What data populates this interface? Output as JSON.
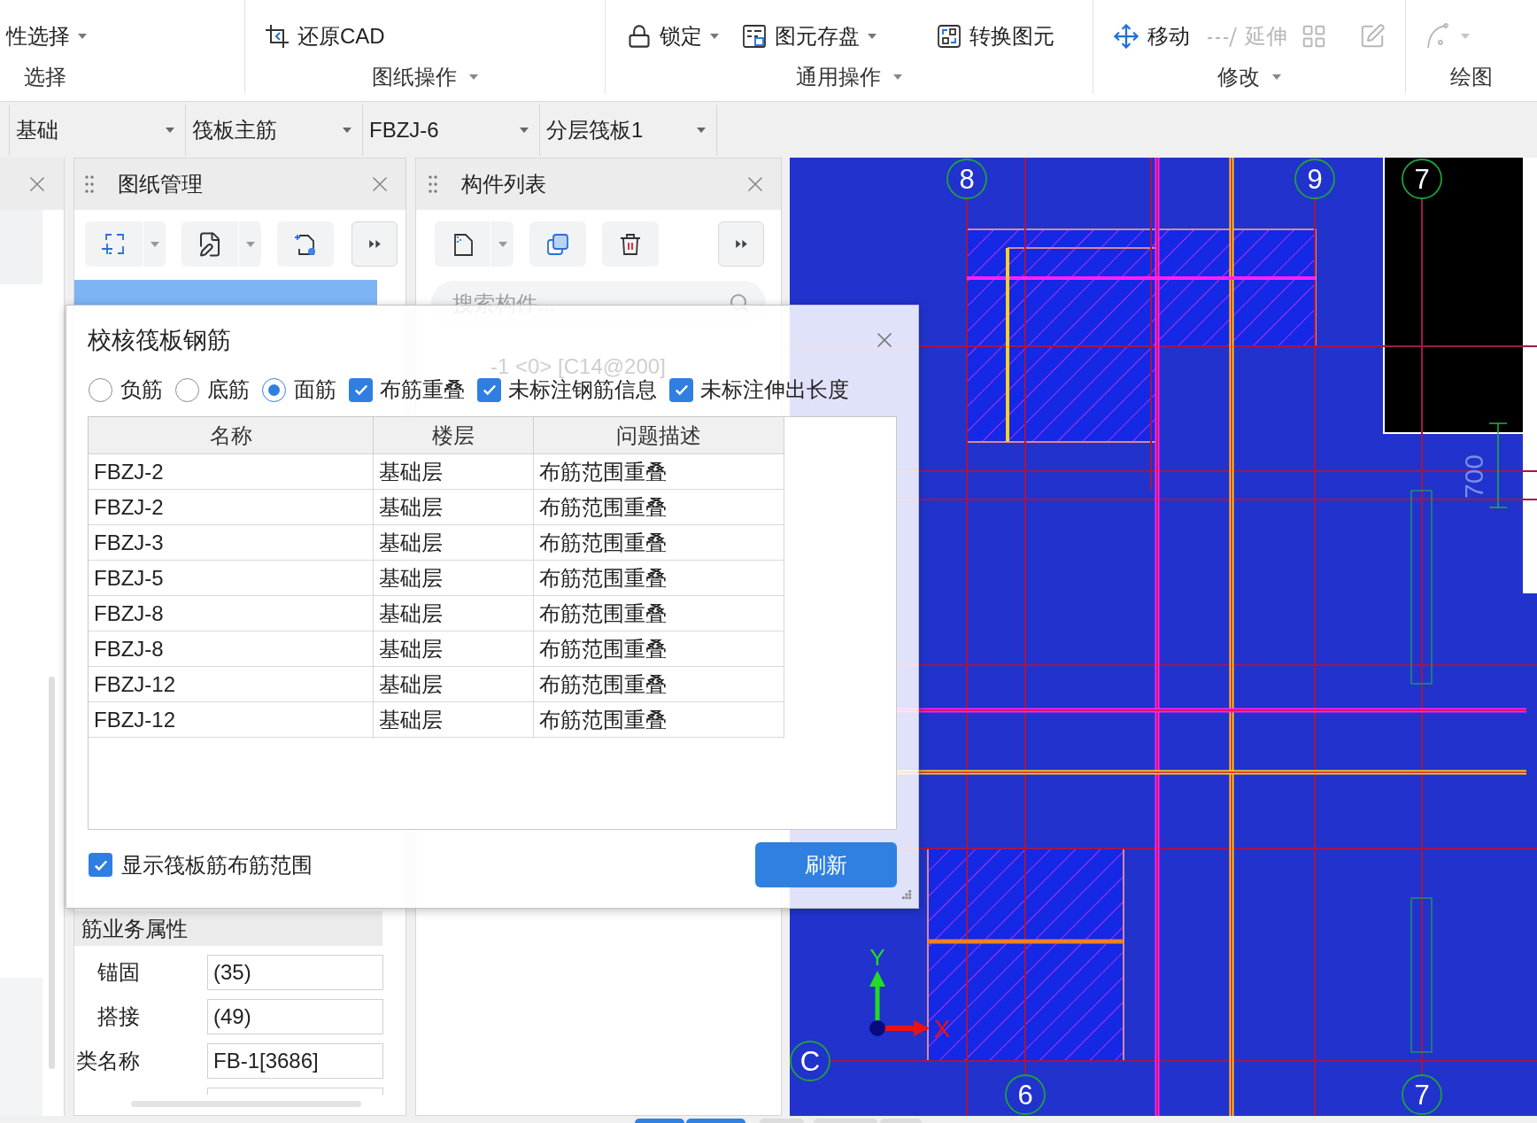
{
  "ribbon": {
    "groups": [
      {
        "label": "选择",
        "dropdown": false,
        "items": [
          {
            "label": "性选择",
            "dropdown": true,
            "disabled": false
          }
        ]
      },
      {
        "label": "图纸操作",
        "dropdown": true,
        "items": [
          {
            "label": "还原CAD",
            "dropdown": false,
            "disabled": false
          }
        ]
      },
      {
        "label": "通用操作",
        "dropdown": true,
        "items": [
          {
            "label": "锁定",
            "dropdown": true,
            "disabled": false
          },
          {
            "label": "图元存盘",
            "dropdown": true,
            "disabled": false
          },
          {
            "label": "转换图元",
            "dropdown": false,
            "disabled": false
          }
        ]
      },
      {
        "label": "修改",
        "dropdown": true,
        "items": [
          {
            "label": "移动",
            "dropdown": false,
            "disabled": false
          },
          {
            "label": "延伸",
            "dropdown": false,
            "disabled": true
          },
          {
            "dropdown": false,
            "disabled": true
          },
          {
            "dropdown": false,
            "disabled": true
          }
        ]
      },
      {
        "label": "绘图",
        "dropdown": false,
        "items": [
          {
            "dropdown": true,
            "disabled": true
          }
        ]
      }
    ]
  },
  "selectors": [
    {
      "value": "基础"
    },
    {
      "value": "筏板主筋"
    },
    {
      "value": "FBZJ-6"
    },
    {
      "value": "分层筏板1"
    }
  ],
  "drawing_panel": {
    "title": "图纸管理",
    "section": {
      "title": "筋业务属性",
      "rows": [
        {
          "label": "锚固",
          "value": "(35)"
        },
        {
          "label": "搭接",
          "value": "(49)"
        },
        {
          "label": "类名称",
          "value": "FB-1[3686]"
        }
      ]
    }
  },
  "component_panel": {
    "title": "构件列表",
    "search": {
      "placeholder": "搜索构件..."
    }
  },
  "canvas": {
    "axis_markers": [
      "8",
      "9",
      "7",
      "C",
      "6",
      "7"
    ],
    "dimension": "700",
    "ucs": {
      "x": "X",
      "y": "Y"
    }
  },
  "dialog": {
    "title": "校核筏板钢筋",
    "background_text": "-1 <0> [C14@200]",
    "bar_types": [
      {
        "label": "负筋",
        "selected": false
      },
      {
        "label": "底筋",
        "selected": false
      },
      {
        "label": "面筋",
        "selected": true
      }
    ],
    "checks": [
      {
        "label": "布筋重叠",
        "checked": true
      },
      {
        "label": "未标注钢筋信息",
        "checked": true
      },
      {
        "label": "未标注伸出长度",
        "checked": true
      }
    ],
    "table": {
      "columns": [
        "名称",
        "楼层",
        "问题描述"
      ],
      "rows": [
        [
          "FBZJ-2",
          "基础层",
          "布筋范围重叠"
        ],
        [
          "FBZJ-2",
          "基础层",
          "布筋范围重叠"
        ],
        [
          "FBZJ-3",
          "基础层",
          "布筋范围重叠"
        ],
        [
          "FBZJ-5",
          "基础层",
          "布筋范围重叠"
        ],
        [
          "FBZJ-8",
          "基础层",
          "布筋范围重叠"
        ],
        [
          "FBZJ-8",
          "基础层",
          "布筋范围重叠"
        ],
        [
          "FBZJ-12",
          "基础层",
          "布筋范围重叠"
        ],
        [
          "FBZJ-12",
          "基础层",
          "布筋范围重叠"
        ]
      ]
    },
    "show_range": {
      "label": "显示筏板筋布筋范围",
      "checked": true
    },
    "button": "刷新"
  }
}
